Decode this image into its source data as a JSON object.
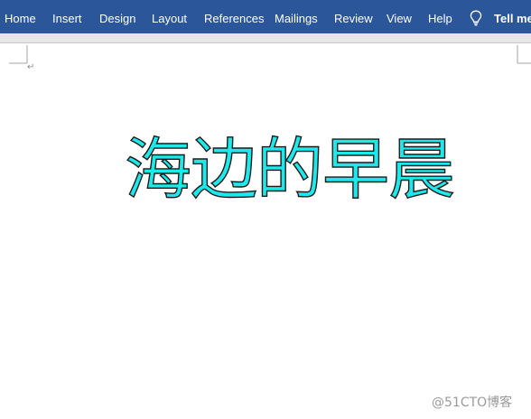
{
  "ribbon": {
    "tabs": [
      {
        "label": "Home"
      },
      {
        "label": "Insert"
      },
      {
        "label": "Design"
      },
      {
        "label": "Layout"
      },
      {
        "label": "References"
      },
      {
        "label": "Mailings"
      },
      {
        "label": "Review"
      },
      {
        "label": "View"
      },
      {
        "label": "Help"
      }
    ],
    "tell_me_label": "Tell me",
    "bulb_icon": "lightbulb-icon"
  },
  "document": {
    "paragraph_mark": "↵",
    "wordart_text": "海边的早晨"
  },
  "watermark": {
    "text": "@51CTO博客"
  },
  "colors": {
    "ribbon_bg": "#2b579a",
    "wordart_fill": "#1ee8ea",
    "wordart_outline": "#1a1a1a"
  }
}
